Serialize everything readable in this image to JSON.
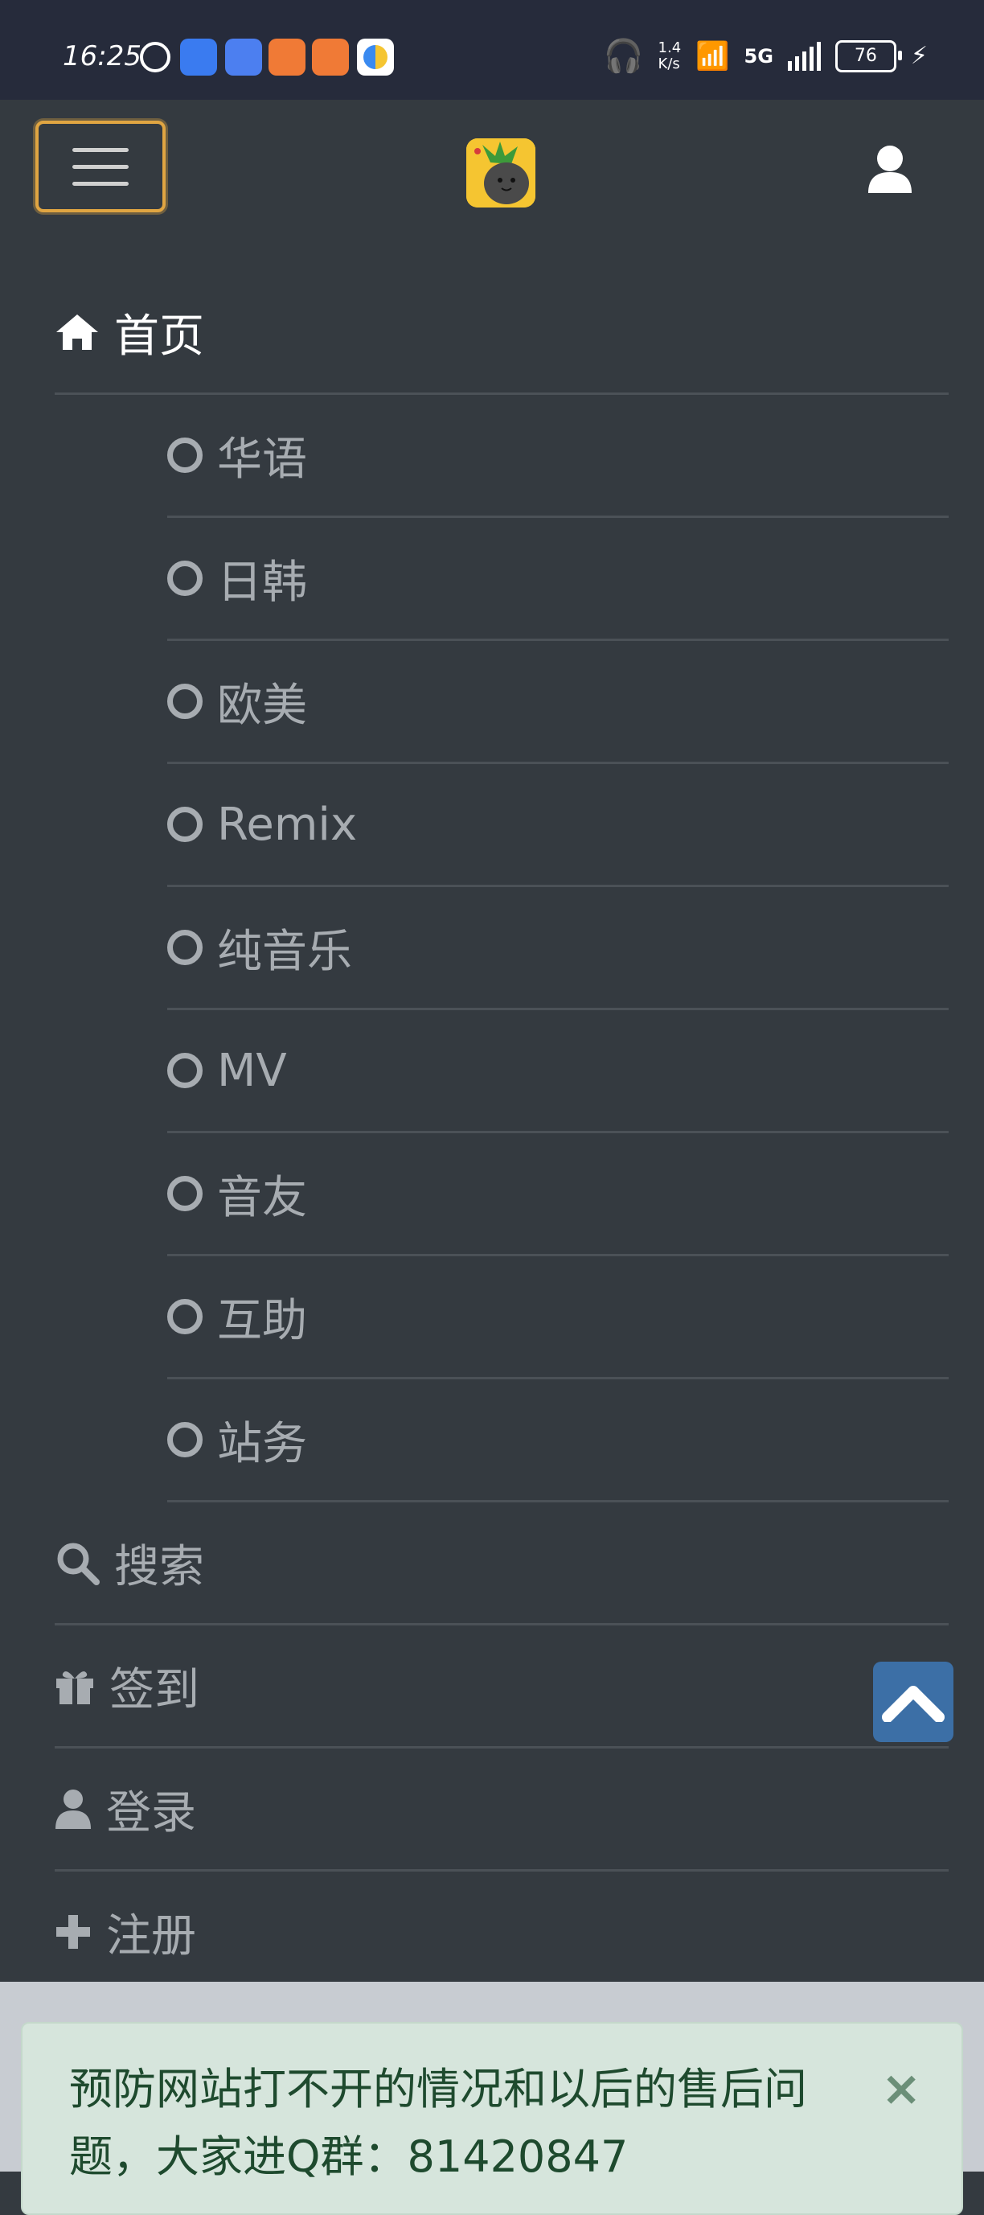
{
  "status_bar": {
    "time": "16:25",
    "net_speed": "1.4\nK/s",
    "network": "5G",
    "battery": "76"
  },
  "navbar": {
    "toggler_icon": "hamburger-icon",
    "logo_icon": "pineapple-logo",
    "user_icon": "user-icon"
  },
  "menu": {
    "home": "首页",
    "subitems": [
      "华语",
      "日韩",
      "欧美",
      "Remix",
      "纯音乐",
      "MV",
      "音友",
      "互助",
      "站务"
    ],
    "search": "搜索",
    "checkin": "签到",
    "login": "登录",
    "register": "注册"
  },
  "alert": {
    "text": "预防网站打不开的情况和以后的售后问题，大家进Q群：81420847",
    "close": "×"
  },
  "colors": {
    "nav_bg": "#343a40",
    "toggler_border": "#e0a542",
    "to_top": "#3c6fa6",
    "alert_bg": "#d6e5dc"
  }
}
